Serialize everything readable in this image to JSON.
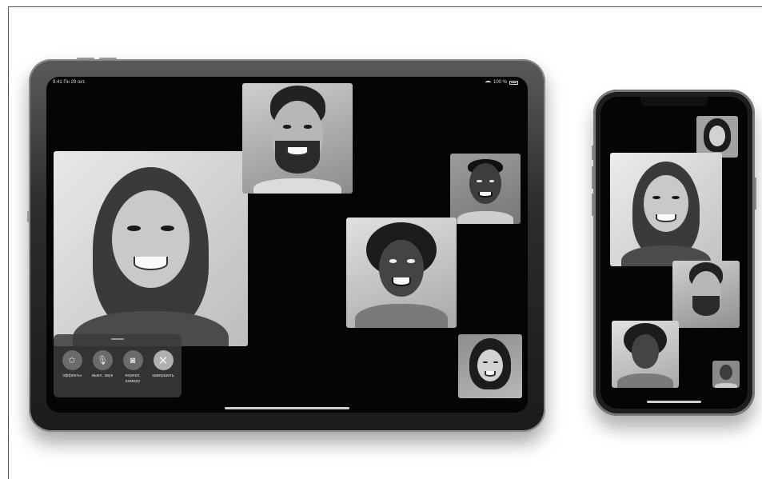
{
  "ipad": {
    "status": {
      "time_date": "9:41  Пн 29 окт.",
      "battery": "100 %"
    },
    "controls": [
      {
        "id": "effects",
        "label": "эффекты",
        "icon": "star-icon",
        "glyph": "✩"
      },
      {
        "id": "mute",
        "label": "выкл. звук",
        "icon": "microphone-icon",
        "glyph": "🎙"
      },
      {
        "id": "flip",
        "label": "перекл. камеру",
        "icon": "camera-icon",
        "glyph": "◙"
      },
      {
        "id": "end",
        "label": "завершить",
        "icon": "close-icon",
        "glyph": "✕"
      }
    ]
  },
  "participants": [
    "participant-woman-long-hair",
    "participant-man-beard",
    "participant-man-short-hair",
    "participant-woman-curly-hair",
    "participant-woman-bangs"
  ],
  "colors": {
    "device_body": "#1e1e1e",
    "screen": "#050505",
    "control_button": "#6b6b6b",
    "end_button": "#b0b0b0"
  }
}
